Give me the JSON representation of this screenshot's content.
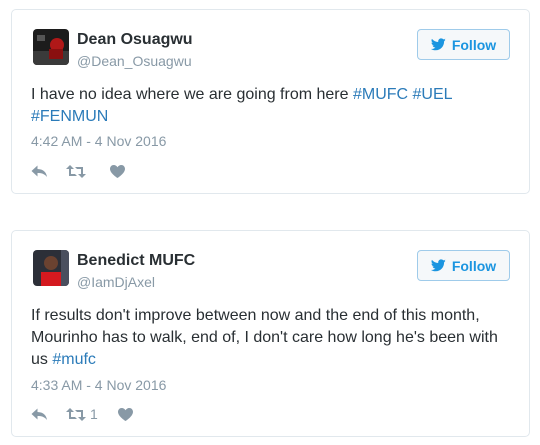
{
  "colors": {
    "link": "#2b7bb9",
    "follow_blue": "#1b95e0",
    "muted": "#8899a6",
    "text": "#292f33",
    "border": "#e1e8ed"
  },
  "tweets": [
    {
      "name": "Dean Osuagwu",
      "handle": "@Dean_Osuagwu",
      "follow_label": "Follow",
      "text_plain": "I have no idea where we are going from here ",
      "hashtags": [
        "#MUFC",
        "#UEL",
        "#FENMUN"
      ],
      "timestamp": "4:42 AM - 4 Nov 2016",
      "retweet_count": "",
      "icons": [
        "reply-icon",
        "retweet-icon",
        "like-icon"
      ]
    },
    {
      "name": "Benedict MUFC",
      "handle": "@IamDjAxel",
      "follow_label": "Follow",
      "text_plain": "If results don't improve between now and the end of this month, Mourinho has to walk, end of, I don't care how long he's been with us ",
      "hashtags": [
        "#mufc"
      ],
      "timestamp": "4:33 AM - 4 Nov 2016",
      "retweet_count": "1",
      "icons": [
        "reply-icon",
        "retweet-icon",
        "like-icon"
      ]
    }
  ]
}
